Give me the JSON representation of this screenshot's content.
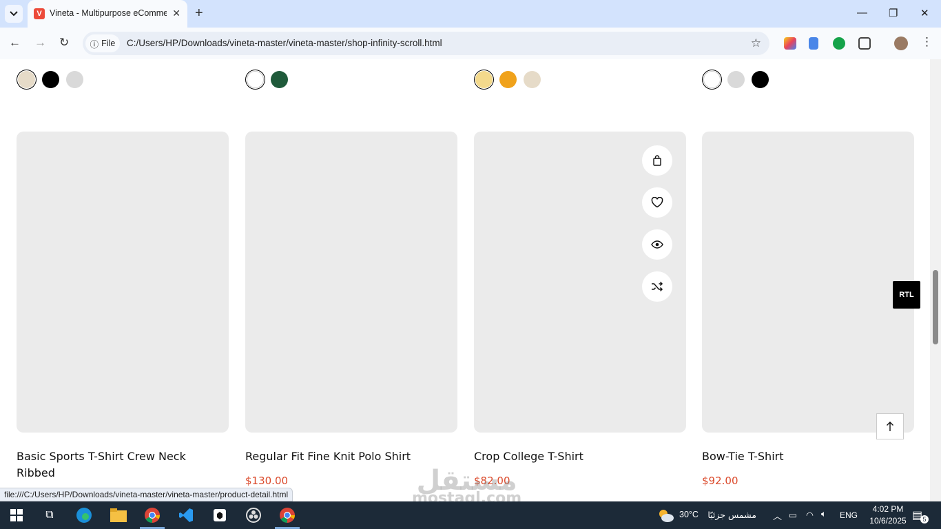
{
  "browser": {
    "tab_title": "Vineta - Multipurpose eCommerce",
    "favicon_letter": "V",
    "address_chip": "File",
    "url": "C:/Users/HP/Downloads/vineta-master/vineta-master/shop-infinity-scroll.html",
    "status_url": "file:///C:/Users/HP/Downloads/vineta-master/vineta-master/product-detail.html"
  },
  "top_swatches": [
    [
      "#e6dbc8",
      "#000000",
      "#d9d9d9"
    ],
    [
      "#ffffff",
      "#1f5a3a"
    ],
    [
      "#f3d98c",
      "#f0a21b",
      "#e6dbc8"
    ],
    [
      "#ffffff",
      "#d9d9d9",
      "#000000"
    ]
  ],
  "products": [
    {
      "name": "Basic Sports T-Shirt Crew Neck Ribbed",
      "price": "",
      "swatches": [
        "#d9d9d9",
        "#8b5e4a"
      ]
    },
    {
      "name": "Regular Fit Fine Knit Polo Shirt",
      "price": "$130.00",
      "swatches": [
        "#8b5e4a"
      ]
    },
    {
      "name": "Crop College T-Shirt",
      "price": "$82.00",
      "swatches": [
        "#1f5a3a",
        "#000000",
        "#d9d9d9"
      ]
    },
    {
      "name": "Bow-Tie T-Shirt",
      "price": "$92.00",
      "swatches": [
        "#000000",
        "#e6dbc8",
        "#ffffff"
      ]
    }
  ],
  "hover_actions": [
    "bag-icon",
    "heart-icon",
    "eye-icon",
    "shuffle-icon"
  ],
  "rtl_label": "RTL",
  "watermark": {
    "arabic": "مستقل",
    "latin": "mostaql.com"
  },
  "taskbar": {
    "weather_temp": "30°C",
    "weather_text": "مشمس جزئيًا",
    "lang": "ENG",
    "time": "4:02 PM",
    "date": "10/6/2025",
    "notifications": "5"
  },
  "colors": {
    "price": "#db4a2b",
    "tab_strip": "#d3e3fd",
    "taskbar": "#1c2a38"
  }
}
